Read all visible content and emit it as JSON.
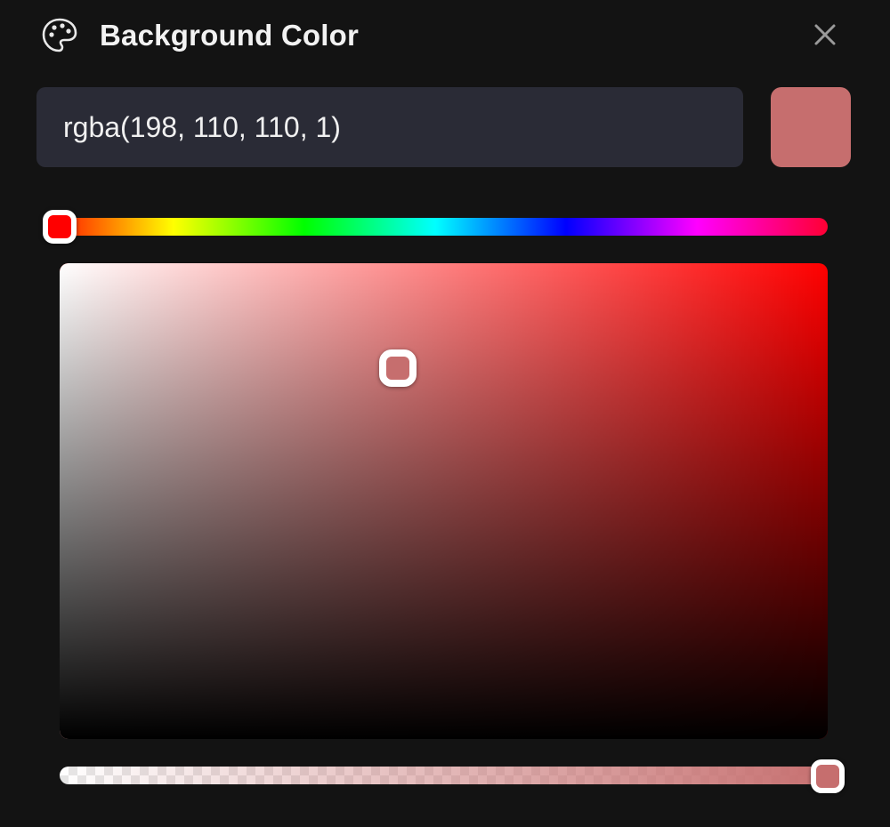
{
  "header": {
    "title": "Background Color",
    "icon": "palette-icon",
    "close_icon": "close-icon"
  },
  "color": {
    "value": "rgba(198, 110, 110, 1)",
    "swatch_hex": "#c66e6e",
    "hue_hex": "#ff0000",
    "hue_degrees": 0,
    "saturation": 0.44,
    "brightness": 0.78,
    "alpha": 1
  }
}
